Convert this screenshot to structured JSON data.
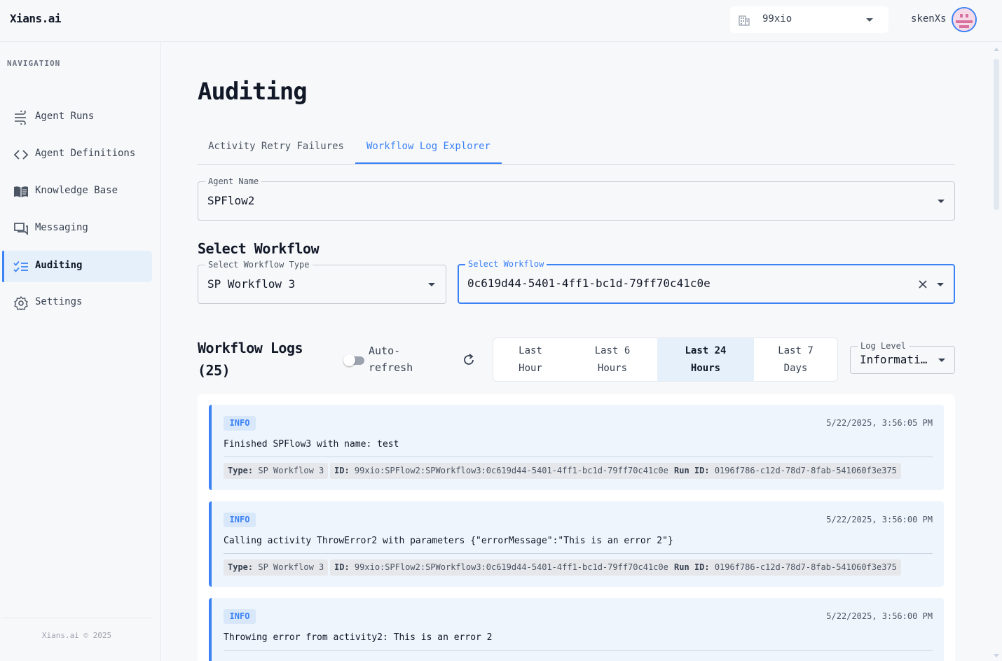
{
  "brand": "Xians.ai",
  "header": {
    "tenant_value": "99xio",
    "user_name": "skenXs"
  },
  "sidebar": {
    "title": "NAVIGATION",
    "items": [
      {
        "label": "Agent Runs",
        "icon": "runs-icon"
      },
      {
        "label": "Agent Definitions",
        "icon": "code-icon"
      },
      {
        "label": "Knowledge Base",
        "icon": "book-icon"
      },
      {
        "label": "Messaging",
        "icon": "chat-icon"
      },
      {
        "label": "Auditing",
        "icon": "checklist-icon",
        "active": true
      },
      {
        "label": "Settings",
        "icon": "gear-icon"
      }
    ],
    "footer": "Xians.ai © 2025"
  },
  "page": {
    "title": "Auditing",
    "tabs": [
      {
        "label": "Activity Retry Failures"
      },
      {
        "label": "Workflow Log Explorer",
        "active": true
      }
    ],
    "agent_name": {
      "label": "Agent Name",
      "value": "SPFlow2"
    },
    "select_workflow_title": "Select Workflow",
    "workflow_type": {
      "label": "Select Workflow Type",
      "value": "SP Workflow 3"
    },
    "workflow": {
      "label": "Select Workflow",
      "value": "0c619d44-5401-4ff1-bc1d-79ff70c41c0e"
    },
    "logs_title_1": "Workflow Logs",
    "logs_title_2": "(25)",
    "auto_refresh_1": "Auto-",
    "auto_refresh_2": "refresh",
    "time_ranges": [
      {
        "l1": "Last",
        "l2": "Hour"
      },
      {
        "l1": "Last 6",
        "l2": "Hours"
      },
      {
        "l1": "Last 24",
        "l2": "Hours",
        "active": true
      },
      {
        "l1": "Last 7",
        "l2": "Days"
      }
    ],
    "log_level": {
      "label": "Log Level",
      "value": "Informati…"
    }
  },
  "logs": [
    {
      "level": "INFO",
      "timestamp": "5/22/2025, 3:56:05 PM",
      "message": "Finished SPFlow3 with name: test",
      "type_key": "Type:",
      "type_val": "SP Workflow 3",
      "id_key": "ID:",
      "id_val": "99xio:SPFlow2:SPWorkflow3:0c619d44-5401-4ff1-bc1d-79ff70c41c0e",
      "run_key": "Run ID:",
      "run_val": "0196f786-c12d-78d7-8fab-541060f3e375"
    },
    {
      "level": "INFO",
      "timestamp": "5/22/2025, 3:56:00 PM",
      "message": "Calling activity ThrowError2 with parameters {\"errorMessage\":\"This is an error 2\"}",
      "type_key": "Type:",
      "type_val": "SP Workflow 3",
      "id_key": "ID:",
      "id_val": "99xio:SPFlow2:SPWorkflow3:0c619d44-5401-4ff1-bc1d-79ff70c41c0e",
      "run_key": "Run ID:",
      "run_val": "0196f786-c12d-78d7-8fab-541060f3e375"
    },
    {
      "level": "INFO",
      "timestamp": "5/22/2025, 3:56:00 PM",
      "message": "Throwing error from activity2: This is an error 2"
    }
  ],
  "colors": {
    "accent": "#3b82f6",
    "active_bg": "#e6f0fb",
    "log_bg": "#eef5fd"
  }
}
